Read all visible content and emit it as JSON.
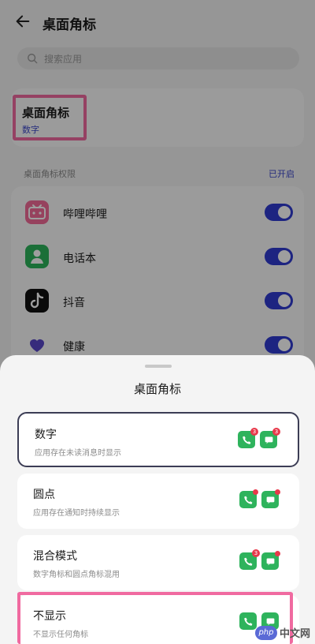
{
  "header": {
    "title": "桌面角标"
  },
  "search": {
    "placeholder": "搜索应用"
  },
  "badge_setting": {
    "title": "桌面角标",
    "value": "数字"
  },
  "permission": {
    "label": "桌面角标权限",
    "status": "已开启"
  },
  "apps": [
    {
      "name": "哔哩哔哩",
      "icon": "bilibili-icon",
      "color": "#f26b98",
      "enabled": true
    },
    {
      "name": "电话本",
      "icon": "contacts-icon",
      "color": "#2db35b",
      "enabled": true
    },
    {
      "name": "抖音",
      "icon": "douyin-icon",
      "color": "#111111",
      "enabled": true
    },
    {
      "name": "健康",
      "icon": "health-heart-icon",
      "color": "#5a48c8",
      "enabled": true
    }
  ],
  "sheet": {
    "title": "桌面角标",
    "options": [
      {
        "title": "数字",
        "desc": "应用存在未读消息时显示",
        "badge": "number",
        "badge_text": "3",
        "selected": true
      },
      {
        "title": "圆点",
        "desc": "应用存在通知时持续显示",
        "badge": "dot",
        "selected": false
      },
      {
        "title": "混合模式",
        "desc": "数字角标和圆点角标混用",
        "badge": "mixed",
        "badge_text": "3",
        "selected": false
      },
      {
        "title": "不显示",
        "desc": "不显示任何角标",
        "badge": "none",
        "selected": false
      }
    ]
  },
  "colors": {
    "accent": "#2f3bd1",
    "highlight": "#f06aa0",
    "badge_red": "#e8394b",
    "app_green": "#2eb35c"
  },
  "watermark": {
    "logo": "php",
    "text": "中文网"
  }
}
